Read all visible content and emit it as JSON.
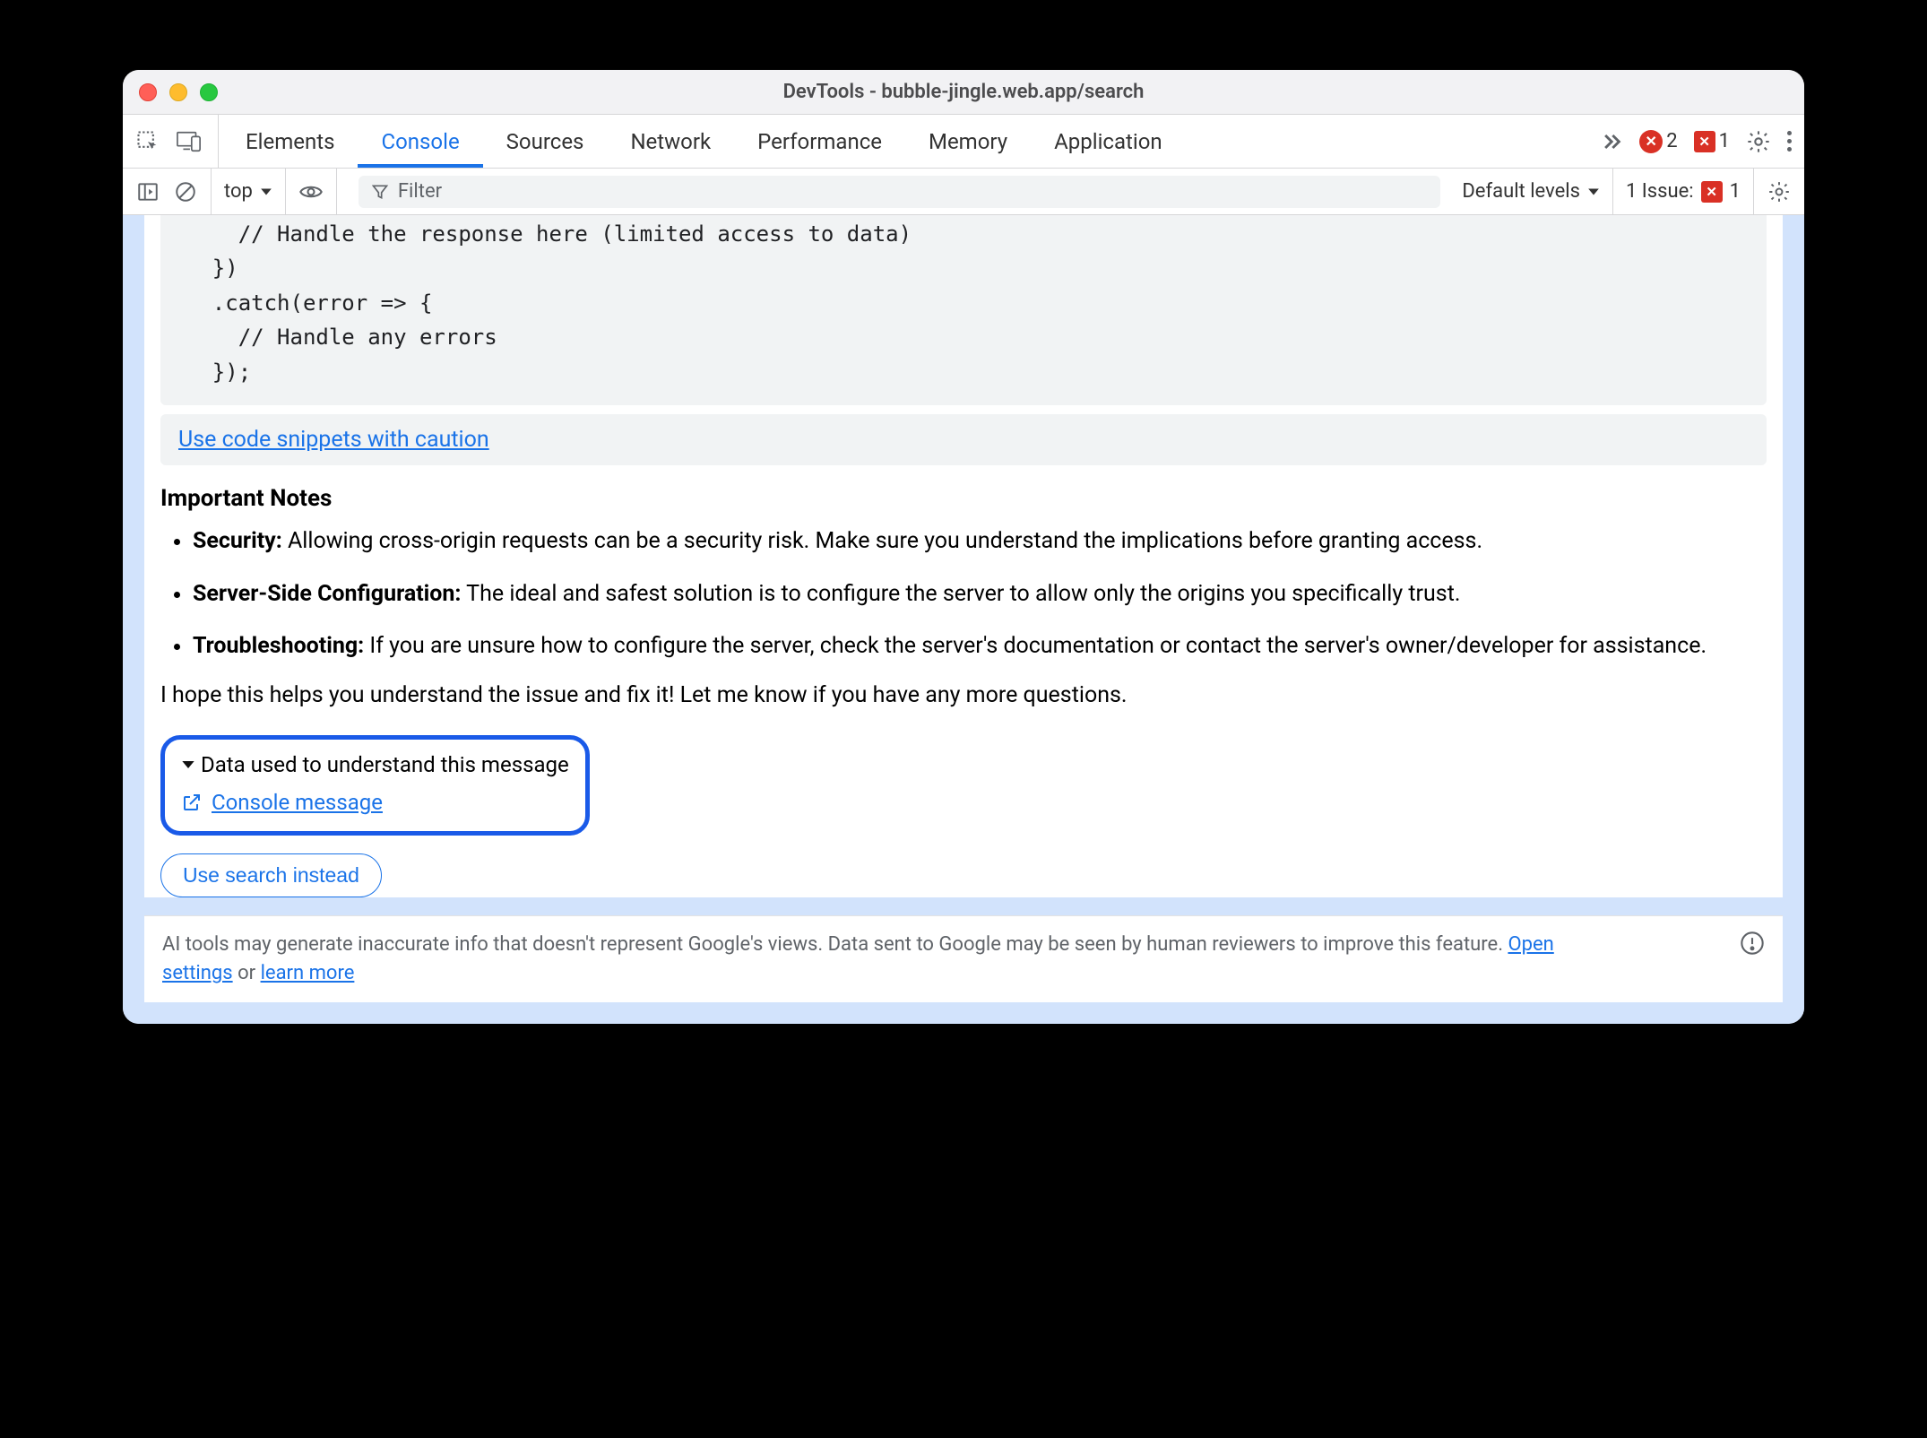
{
  "window": {
    "title": "DevTools - bubble-jingle.web.app/search"
  },
  "toolbar": {
    "tabs": [
      "Elements",
      "Console",
      "Sources",
      "Network",
      "Performance",
      "Memory",
      "Application"
    ],
    "active_tab_index": 1,
    "errors_count": "2",
    "issues_count": "1"
  },
  "subbar": {
    "context": "top",
    "filter_placeholder": "Filter",
    "levels_label": "Default levels",
    "issue_summary_prefix": "1 Issue:",
    "issue_summary_count": "1"
  },
  "code_lines": "      // Handle the response here (limited access to data)\n    })\n    .catch(error => {\n      // Handle any errors\n    });",
  "snippet_banner_link": "Use code snippets with caution",
  "notes_heading": "Important Notes",
  "notes": [
    {
      "bold": "Security:",
      "text": " Allowing cross-origin requests can be a security risk. Make sure you understand the implications before granting access."
    },
    {
      "bold": "Server-Side Configuration:",
      "text": " The ideal and safest solution is to configure the server to allow only the origins you specifically trust."
    },
    {
      "bold": "Troubleshooting:",
      "text": " If you are unsure how to configure the server, check the server's documentation or contact the server's owner/developer for assistance."
    }
  ],
  "closing": "I hope this helps you understand the issue and fix it! Let me know if you have any more questions.",
  "data_used_label": "Data used to understand this message",
  "console_message_link": "Console message",
  "search_button": "Use search instead",
  "footer": {
    "text_a": "AI tools may generate inaccurate info that doesn't represent Google's views. Data sent to Google may be seen by human reviewers to improve this feature. ",
    "open_settings": "Open settings",
    "or": " or ",
    "learn_more": "learn more"
  }
}
